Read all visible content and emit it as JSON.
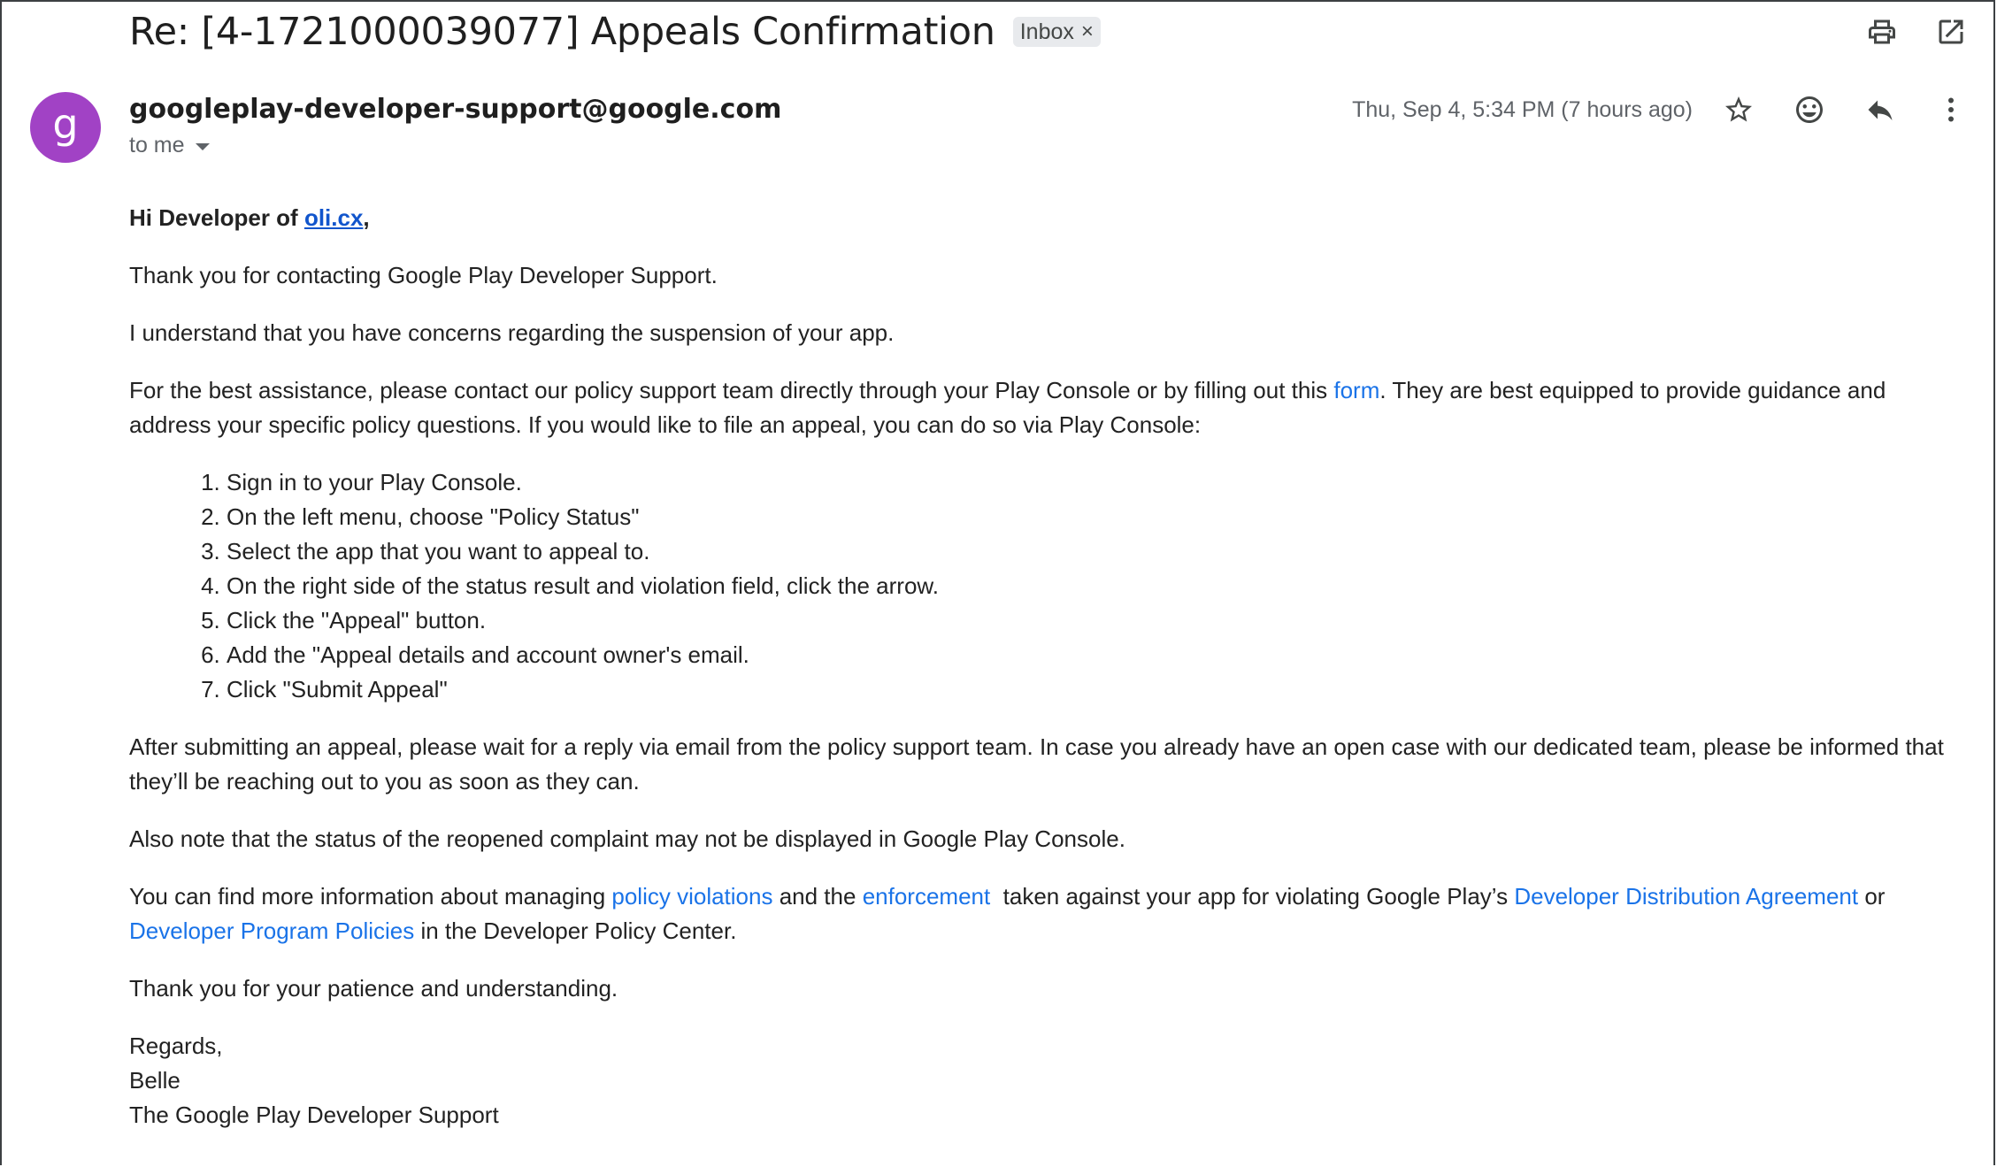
{
  "header": {
    "subject": "Re: [4-1721000039077] Appeals Confirmation",
    "label": "Inbox",
    "label_remove": "×"
  },
  "top_actions": [
    {
      "name": "print-icon"
    },
    {
      "name": "open-in-new-window-icon"
    }
  ],
  "message": {
    "avatar_letter": "g",
    "avatar_color": "#a142c5",
    "sender": "googleplay-developer-support@google.com",
    "recipient": "to me",
    "timestamp": "Thu, Sep 4, 5:34 PM (7 hours ago)"
  },
  "message_actions": [
    {
      "name": "star-icon"
    },
    {
      "name": "emoji-reaction-icon"
    },
    {
      "name": "reply-icon"
    },
    {
      "name": "more-vert-icon"
    }
  ],
  "body": {
    "greeting_prefix": "Hi Developer of ",
    "greeting_link": "oli.cx",
    "greeting_suffix": ",",
    "p1": "Thank you for contacting Google Play Developer Support.",
    "p2": "I understand that you have concerns regarding the suspension of your app.",
    "p3_a": "For the best assistance, please contact our policy support team directly through your Play Console or by filling out this ",
    "p3_link": "form",
    "p3_b": ". They are best equipped to provide guidance and address your specific policy questions. If you would like to file an appeal, you can do so via Play Console:",
    "steps": [
      "Sign in to your Play Console.",
      "On the left menu, choose \"Policy Status\"",
      "Select the app that you want to appeal to.",
      "On the right side of the status result and violation field, click the arrow.",
      "Click the \"Appeal\" button.",
      "Add the \"Appeal details and account owner's email.",
      "Click \"Submit Appeal\""
    ],
    "p4": "After submitting an appeal, please wait for a reply via email from the policy support team. In case you already have an open case with our dedicated team, please be informed that they’ll be reaching out to you as soon as they can.",
    "p5": "Also note that the status of the reopened complaint may not be displayed in Google Play Console.",
    "p6_a": "You can find more information about managing ",
    "p6_link1": "policy violations",
    "p6_b": " and the ",
    "p6_link2": "enforcement",
    "p6_c": "  taken against your app for violating Google Play’s ",
    "p6_link3": "Developer Distribution Agreement",
    "p6_d": " or ",
    "p6_link4": "Developer Program Policies",
    "p6_e": " in the Developer Policy Center.",
    "p7": "Thank you for your patience and understanding.",
    "sig_regards": "Regards,",
    "sig_name": "Belle",
    "sig_team": "The Google Play Developer Support"
  }
}
